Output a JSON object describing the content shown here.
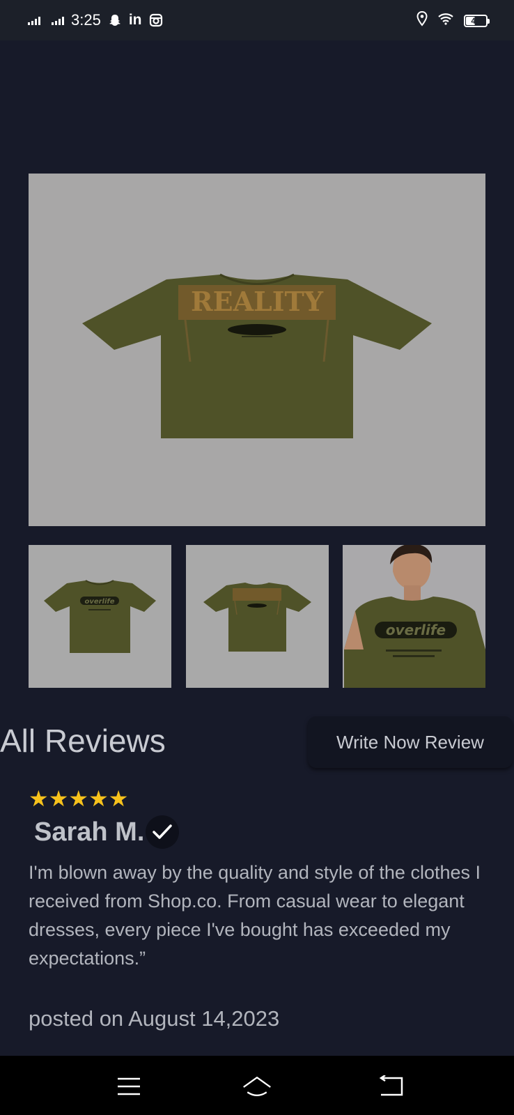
{
  "status_bar": {
    "time": "3:25",
    "battery": "47",
    "battery_level": 0.47,
    "icons": [
      "signal-icon",
      "signal-icon",
      "snapchat-icon",
      "linkedin-icon",
      "instagram-icon",
      "location-icon",
      "wifi-icon",
      "battery-icon"
    ]
  },
  "product": {
    "main_image": "olive-tshirt-back-print",
    "thumbnails": [
      "olive-tshirt-front",
      "olive-tshirt-back",
      "model-wearing-olive-tshirt"
    ],
    "main_print_text": "REALITY",
    "thumb_print_text": "overlife"
  },
  "reviews": {
    "title": "All Reviews",
    "write_button": "Write Now Review",
    "items": [
      {
        "stars": "★★★★★",
        "rating": 5,
        "name": "Sarah M.",
        "text": "I'm blown away by the quality and style of the clothes I received from Shop.co. From casual wear to elegant dresses, every piece I've bought has exceeded my expectations.”",
        "posted": "posted on August 14,2023"
      }
    ]
  },
  "nav": {
    "icons": [
      "menu-icon",
      "home-icon",
      "back-icon"
    ]
  },
  "colors": {
    "background": "#171a29",
    "star": "#f7c21c",
    "shirt": "#4f5228"
  }
}
